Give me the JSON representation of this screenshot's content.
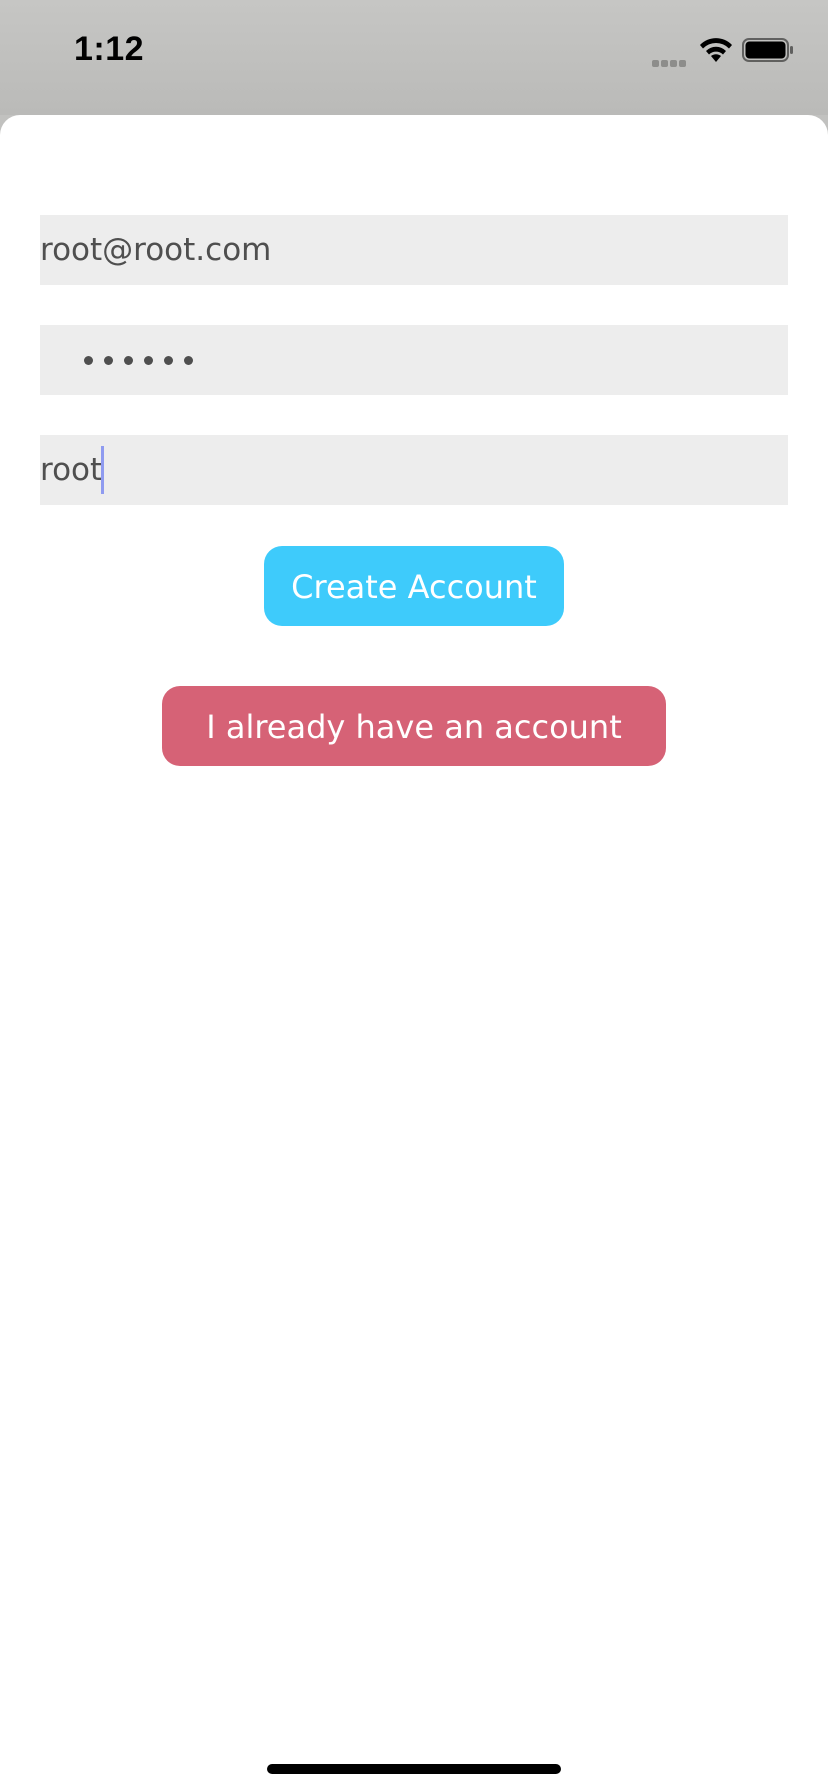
{
  "status_bar": {
    "time": "1:12",
    "signal_icon": "cellular-signal-icon",
    "wifi_icon": "wifi-icon",
    "battery_icon": "battery-icon"
  },
  "form": {
    "email": {
      "value": "root@root.com"
    },
    "password": {
      "value": "••••••",
      "dot_count": 6
    },
    "username": {
      "value": "root"
    }
  },
  "buttons": {
    "create_account": "Create Account",
    "have_account": "I already have an account"
  },
  "colors": {
    "create_button": "#3ecbfb",
    "login_button": "#d66276",
    "field_background": "#ededed",
    "cursor": "#8f9bf0"
  }
}
